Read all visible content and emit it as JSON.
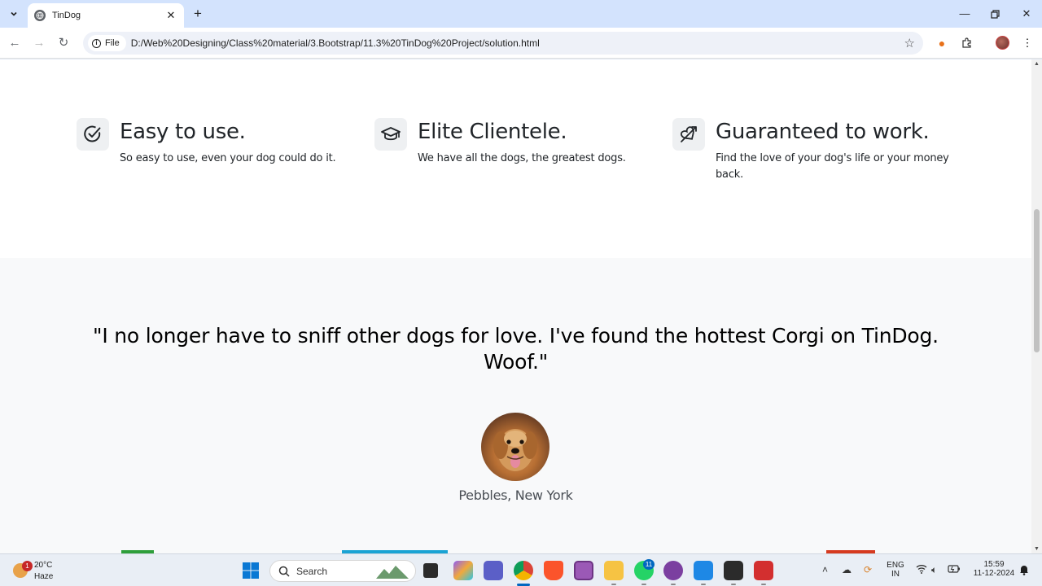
{
  "browser": {
    "tab_title": "TinDog",
    "new_tab_label": "+",
    "site_chip_label": "File",
    "url": "D:/Web%20Designing/Class%20material/3.Bootstrap/11.3%20TinDog%20Project/solution.html"
  },
  "features": [
    {
      "title": "Easy to use.",
      "text": "So easy to use, even your dog could do it.",
      "icon": "check-circle-icon"
    },
    {
      "title": "Elite Clientele.",
      "text": "We have all the dogs, the greatest dogs.",
      "icon": "mortarboard-icon"
    },
    {
      "title": "Guaranteed to work.",
      "text": "Find the love of your dog's life or your money back.",
      "icon": "heart-arrow-icon"
    }
  ],
  "testimonial": {
    "quote": "\"I no longer have to sniff other dogs for love. I've found the hottest Corgi on TinDog. Woof.\"",
    "caption": "Pebbles, New York"
  },
  "taskbar": {
    "weather_temp": "20°C",
    "weather_cond": "Haze",
    "weather_badge": "1",
    "search_label": "Search",
    "whatsapp_badge": "11",
    "lang_line1": "ENG",
    "lang_line2": "IN",
    "time": "15:59",
    "date": "11-12-2024"
  },
  "colors": {
    "accent": "#0067c0",
    "testimonial_bg": "#f8f9fa",
    "tabbar_bg": "#d3e3fd"
  }
}
